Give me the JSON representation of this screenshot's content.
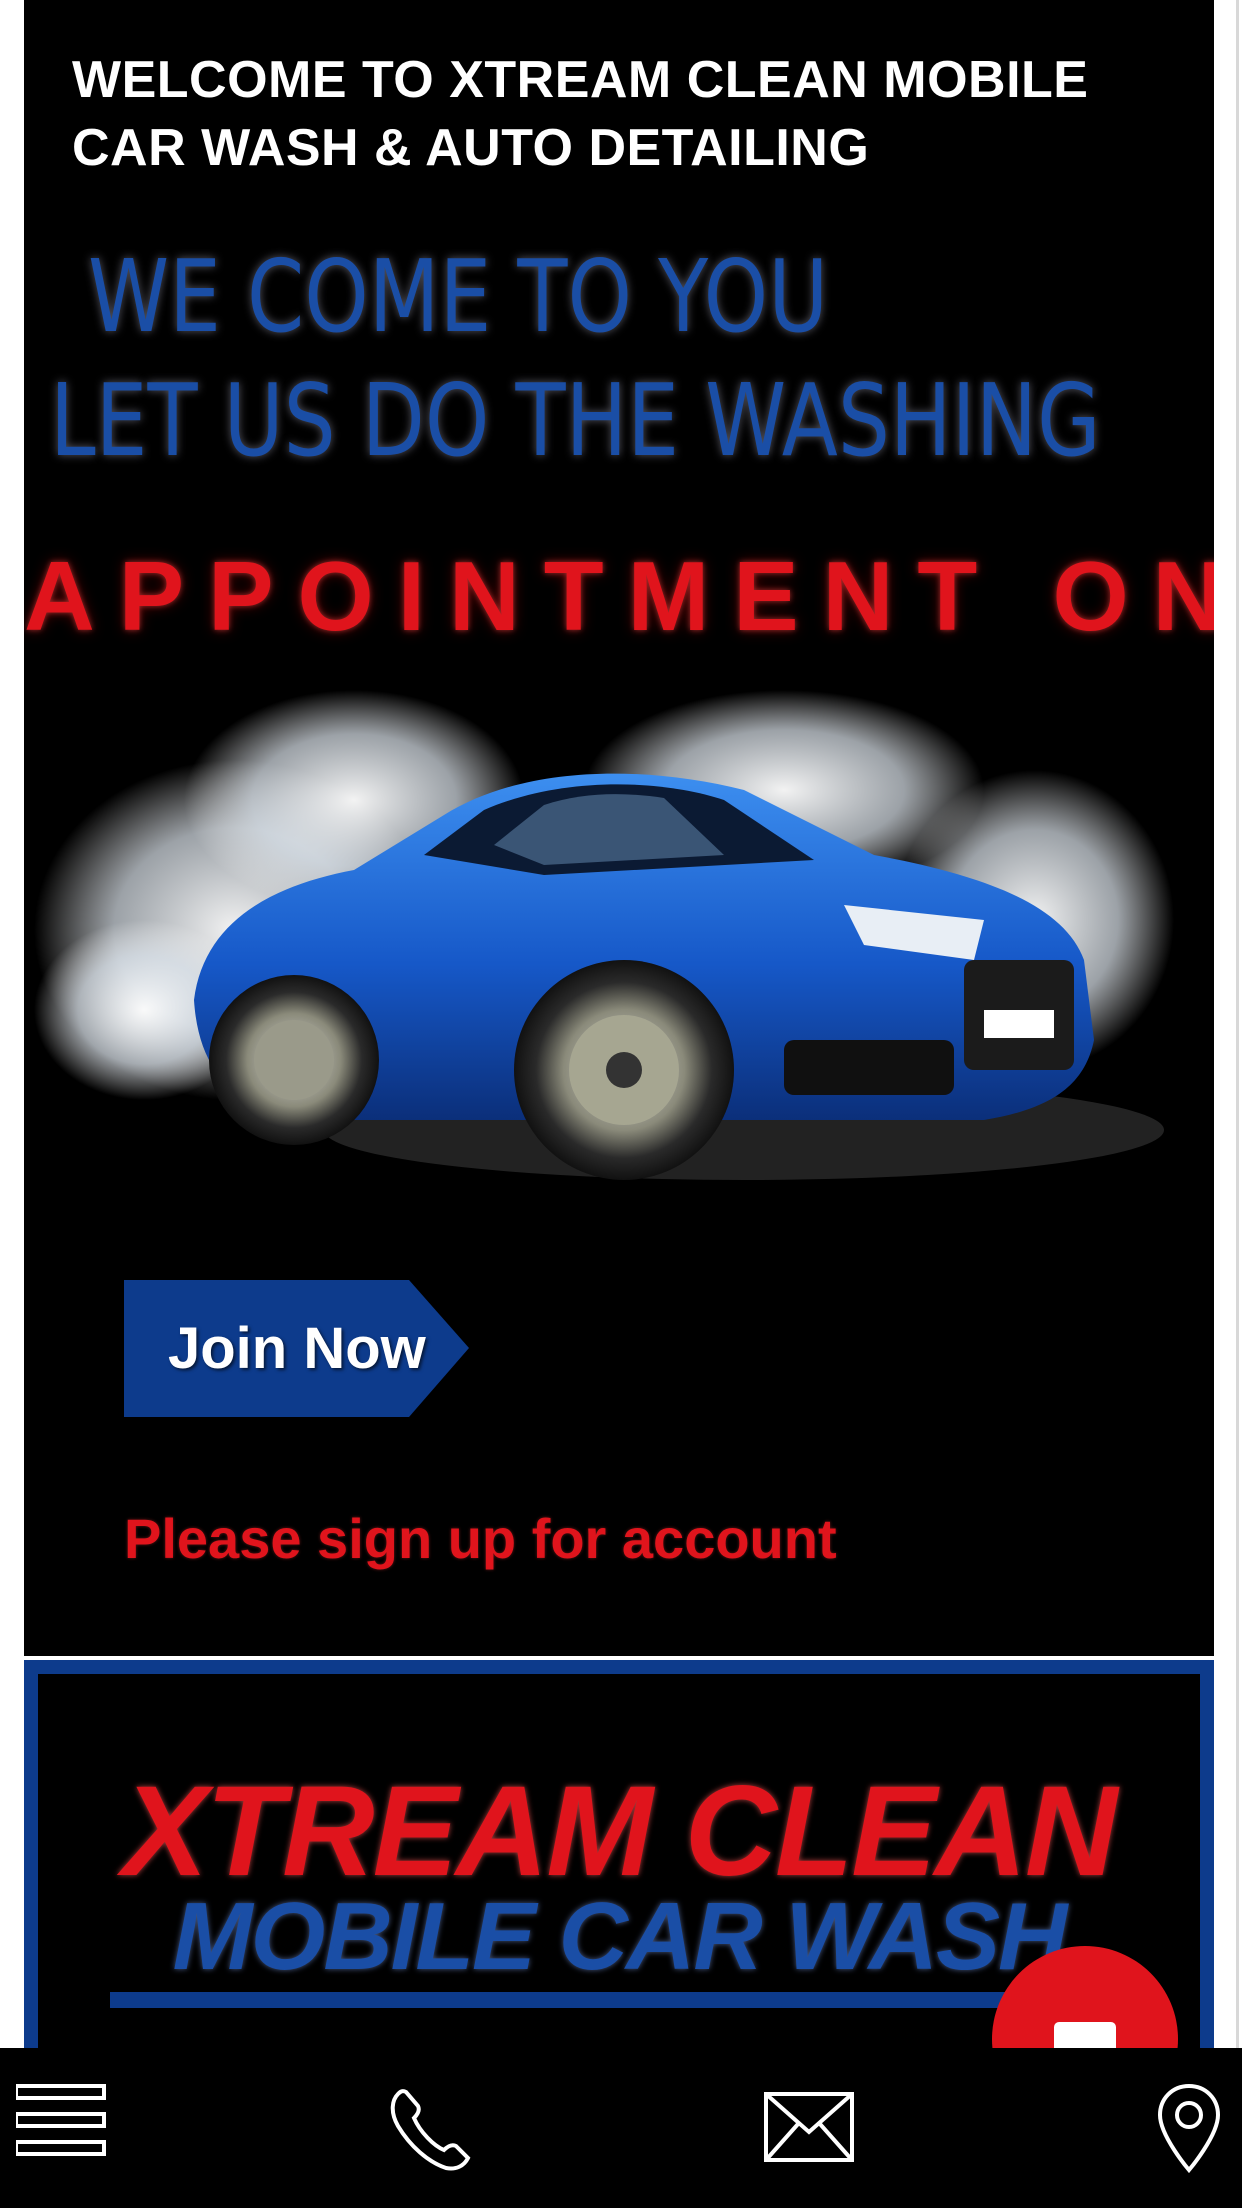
{
  "header": {
    "welcome": "WELCOME TO XTREAM CLEAN MOBILE CAR WASH & AUTO DETAILING",
    "tagline_line1": "WE COME TO YOU",
    "tagline_line2": "LET US DO THE WASHING",
    "marquee": "APPOINTMENT ON"
  },
  "cta": {
    "join_label": "Join Now",
    "signup_prompt": "Please sign up for account"
  },
  "logo": {
    "line1": "XTREAM CLEAN",
    "line2": "MOBILE CAR WASH"
  },
  "bottom_nav": {
    "items": [
      "menu-icon",
      "phone-icon",
      "mail-icon",
      "location-pin-icon"
    ]
  },
  "colors": {
    "background": "#000000",
    "brand_red": "#e0141c",
    "brand_blue": "#0d3b8c",
    "tagline_blue": "#1a4ea6"
  }
}
